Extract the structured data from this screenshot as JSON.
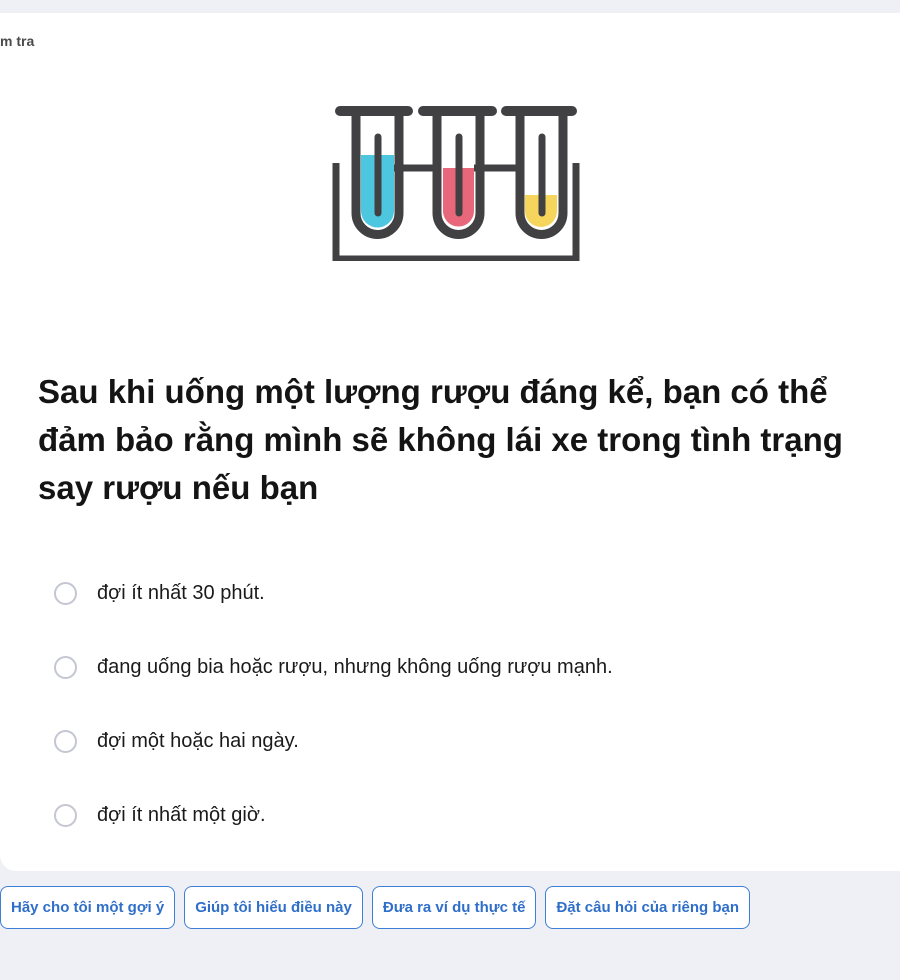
{
  "card": {
    "label": "m tra"
  },
  "illustration": {
    "icon": "test-tubes-icon",
    "colors": {
      "frame": "#414042",
      "tube_1_liquid": "#4dc6e0",
      "tube_2_liquid": "#e8677a",
      "tube_3_liquid": "#f5d55c"
    }
  },
  "question": {
    "text": "Sau khi uống một lượng rượu đáng kể, bạn có thể đảm bảo rằng mình sẽ không lái xe trong tình trạng say rượu nếu bạn"
  },
  "options": [
    {
      "label": "đợi ít nhất 30 phút."
    },
    {
      "label": "đang uống bia hoặc rượu, nhưng không uống rượu mạnh."
    },
    {
      "label": "đợi một hoặc hai ngày."
    },
    {
      "label": "đợi ít nhất một giờ."
    }
  ],
  "help_actions": [
    {
      "label": "Hãy cho tôi một gợi ý"
    },
    {
      "label": "Giúp tôi hiểu điều này"
    },
    {
      "label": "Đưa ra ví dụ thực tế"
    },
    {
      "label": "Đặt câu hỏi của riêng bạn"
    }
  ],
  "colors": {
    "page_background": "#eff0f5",
    "card_background": "#ffffff",
    "accent": "#2f6fc9",
    "radio_border": "#c4c6d2"
  }
}
